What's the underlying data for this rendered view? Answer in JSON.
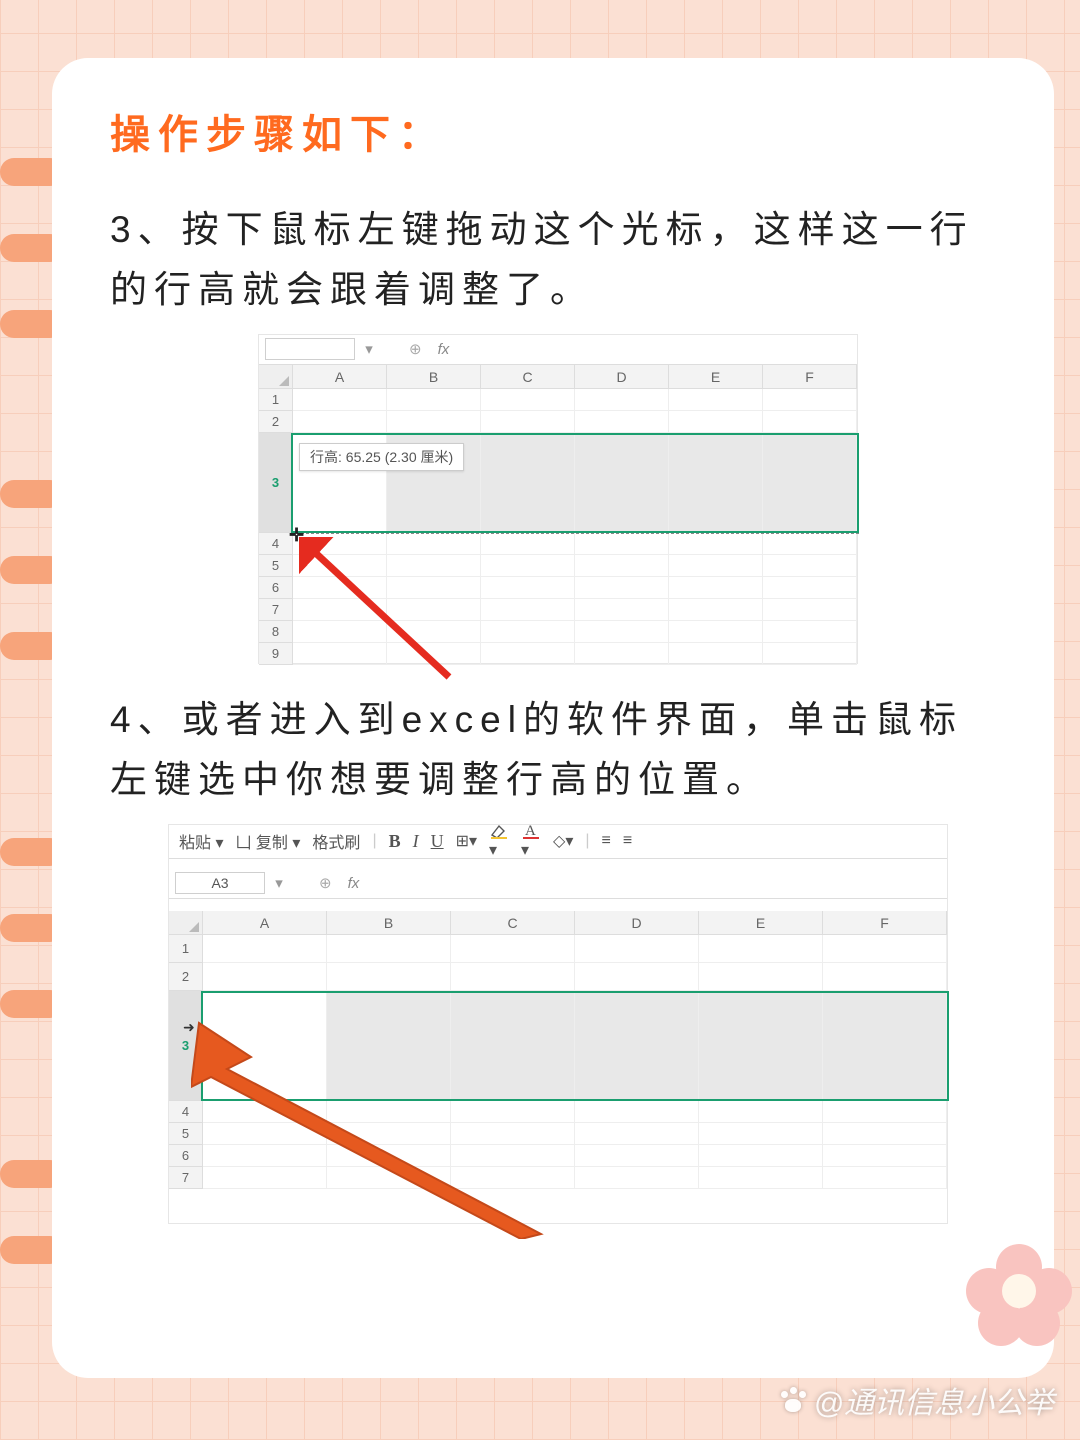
{
  "title": "操作步骤如下：",
  "step3": "3、按下鼠标左键拖动这个光标，这样这一行的行高就会跟着调整了。",
  "step4": "4、或者进入到excel的软件界面，单击鼠标左键选中你想要调整行高的位置。",
  "shot1": {
    "namebox": "",
    "fx": "fx",
    "cols": [
      "A",
      "B",
      "C",
      "D",
      "E",
      "F"
    ],
    "rows": [
      "1",
      "2",
      "3",
      "4",
      "5",
      "6",
      "7",
      "8",
      "9"
    ],
    "tooltip": "行高: 65.25 (2.30 厘米)"
  },
  "shot2": {
    "toolbar": {
      "paste": "粘贴 ▾",
      "copy": "凵 复制 ▾",
      "fmt": "格式刷"
    },
    "namebox": "A3",
    "fx": "fx",
    "cols": [
      "A",
      "B",
      "C",
      "D",
      "E",
      "F"
    ],
    "rows": [
      "1",
      "2",
      "3",
      "4",
      "5",
      "6",
      "7"
    ]
  },
  "watermark": "@通讯信息小公举"
}
